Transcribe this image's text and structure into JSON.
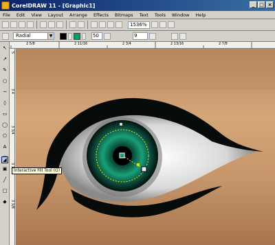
{
  "window": {
    "title": "CorelDRAW 11 - [Graphic1]"
  },
  "menu": [
    "File",
    "Edit",
    "View",
    "Layout",
    "Arrange",
    "Effects",
    "Bitmaps",
    "Text",
    "Tools",
    "Window",
    "Help"
  ],
  "toolbar": {
    "zoom": "1536%"
  },
  "property_bar": {
    "fill_type": "Radial",
    "from_color": "#000000",
    "to_color": "#00a060",
    "midpoint": "50",
    "steps": "9"
  },
  "rulers": {
    "horizontal": [
      "2 5/8",
      "2 11/16",
      "2 3/4",
      "2 13/16",
      "2 7/8"
    ],
    "vertical": [
      "5",
      "3 4",
      "3 3/4",
      "3 1/2",
      "3 3/8"
    ]
  },
  "tooltip": "Interactive Fill Tool (G)",
  "colors": {
    "title_start": "#0a246a",
    "title_end": "#3a6ea5",
    "eyeliner": "#060a08",
    "iris_outer": "#0c4a3c",
    "iris_inner": "#18a078",
    "skin": "#c99a6a"
  },
  "icons": [
    "pick-icon",
    "shape-icon",
    "knife-icon",
    "zoom-icon",
    "freehand-icon",
    "smart-icon",
    "rectangle-icon",
    "ellipse-icon",
    "polygon-icon",
    "text-icon",
    "table-icon",
    "blend-icon",
    "eyedropper-icon",
    "outline-icon",
    "fill-icon",
    "interactive-fill-icon"
  ]
}
